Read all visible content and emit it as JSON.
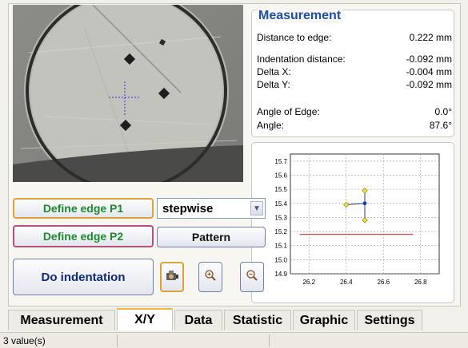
{
  "measurement": {
    "title": "Measurement",
    "rows": [
      {
        "label": "Distance to edge:",
        "value": "0.222 mm"
      },
      {
        "label": "Indentation distance:",
        "value": "-0.092 mm"
      },
      {
        "label": "Delta X:",
        "value": "-0.004 mm"
      },
      {
        "label": "Delta Y:",
        "value": "-0.092 mm"
      },
      {
        "label": "Angle of Edge:",
        "value": "0.0°"
      },
      {
        "label": "Angle:",
        "value": "87.6°"
      }
    ]
  },
  "buttons": {
    "define_edge_p1": "Define edge P1",
    "define_edge_p2": "Define edge P2",
    "pattern": "Pattern",
    "do_indentation": "Do indentation"
  },
  "mode_select": {
    "value": "stepwise"
  },
  "icons": {
    "camera": "camera-icon",
    "zoom_in": "zoom-in-icon",
    "zoom_out": "zoom-out-icon"
  },
  "tabs": [
    {
      "label": "Measurement"
    },
    {
      "label": "X/Y"
    },
    {
      "label": "Data"
    },
    {
      "label": "Statistic"
    },
    {
      "label": "Graphic"
    },
    {
      "label": "Settings"
    }
  ],
  "status": {
    "text": "3 value(s)"
  },
  "chart_data": {
    "type": "scatter",
    "x_ticks": [
      "26.2",
      "26.4",
      "26.6",
      "26.8"
    ],
    "y_ticks": [
      "14.9",
      "15.0",
      "15.1",
      "15.2",
      "15.3",
      "15.4",
      "15.5",
      "15.6",
      "15.7"
    ],
    "xlim": [
      26.1,
      26.9
    ],
    "ylim": [
      14.9,
      15.75
    ],
    "grid": true,
    "points": [
      {
        "x": 26.4,
        "y": 15.39
      },
      {
        "x": 26.5,
        "y": 15.49
      },
      {
        "x": 26.5,
        "y": 15.28
      }
    ],
    "center_point": {
      "x": 26.5,
      "y": 15.4
    },
    "edge_line": {
      "x1": 26.15,
      "x2": 26.76,
      "y": 15.18
    },
    "colors": {
      "points": "#f5e642",
      "center": "#1d3a9c",
      "edge": "#d84a4a",
      "grid": "#9a9a9a"
    }
  }
}
